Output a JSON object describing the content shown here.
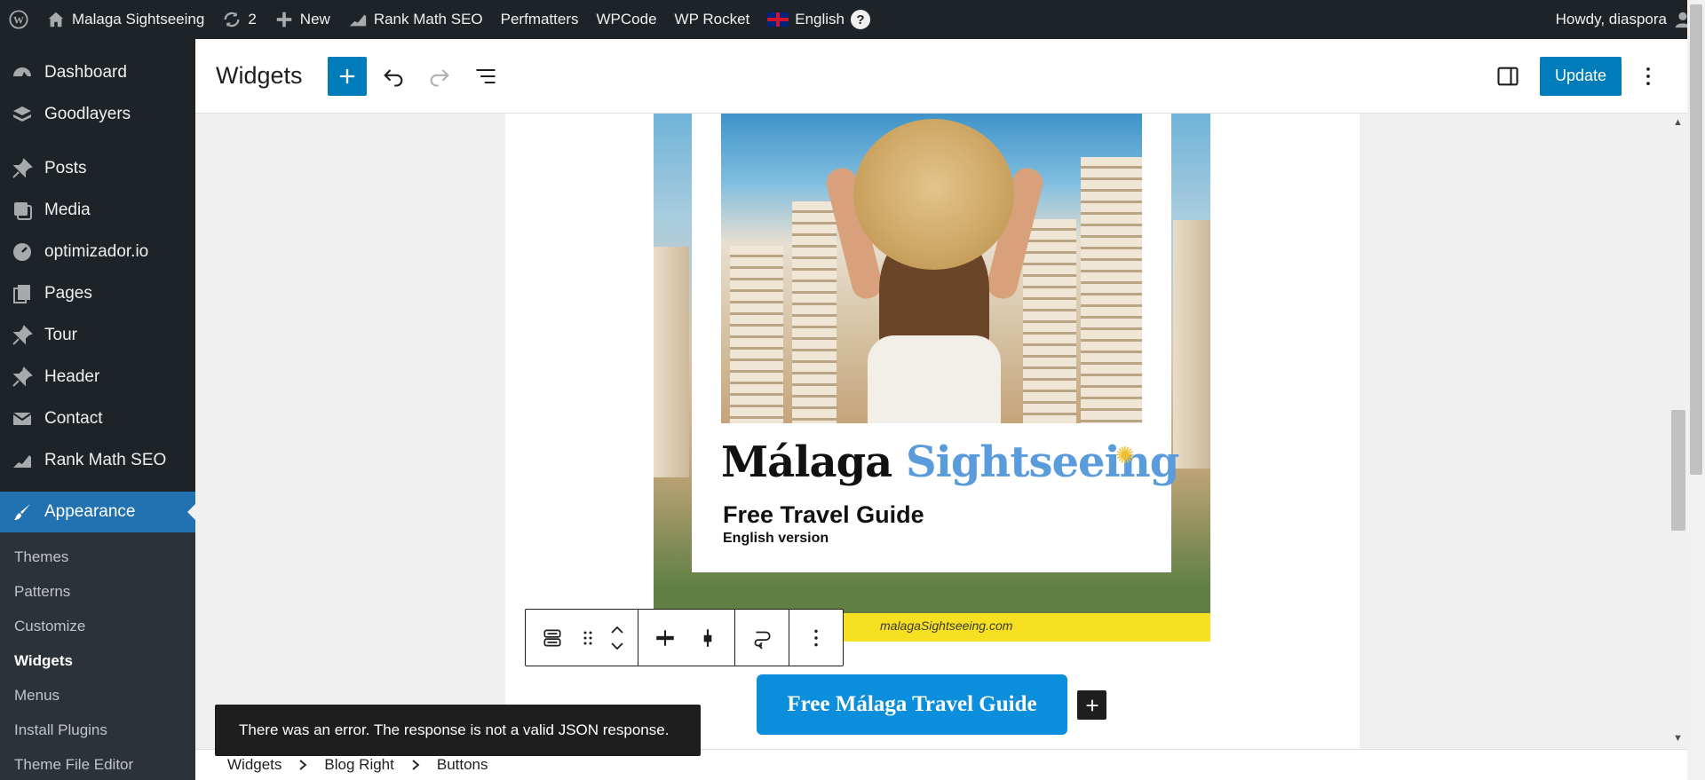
{
  "adminbar": {
    "site_name": "Malaga Sightseeing",
    "updates_count": "2",
    "new_label": "New",
    "rank_math": "Rank Math SEO",
    "perfmatters": "Perfmatters",
    "wpcode": "WPCode",
    "wp_rocket": "WP Rocket",
    "language": "English",
    "help": "?",
    "howdy": "Howdy, diaspora"
  },
  "sidebar": {
    "items": [
      {
        "label": "Dashboard",
        "icon": "dashboard-icon"
      },
      {
        "label": "Goodlayers",
        "icon": "layers-icon"
      },
      {
        "label": "Posts",
        "icon": "pin-icon"
      },
      {
        "label": "Media",
        "icon": "media-icon"
      },
      {
        "label": "optimizador.io",
        "icon": "gauge-icon"
      },
      {
        "label": "Pages",
        "icon": "pages-icon"
      },
      {
        "label": "Tour",
        "icon": "pin-icon"
      },
      {
        "label": "Header",
        "icon": "pin-icon"
      },
      {
        "label": "Contact",
        "icon": "mail-icon"
      },
      {
        "label": "Rank Math SEO",
        "icon": "rank-math-icon"
      }
    ],
    "active": {
      "label": "Appearance",
      "icon": "brush-icon"
    },
    "submenu": [
      "Themes",
      "Patterns",
      "Customize",
      "Widgets",
      "Menus",
      "Install Plugins",
      "Theme File Editor"
    ],
    "current_submenu": "Widgets"
  },
  "editor": {
    "title": "Widgets",
    "update_label": "Update"
  },
  "promo": {
    "brand_part1": "Málaga",
    "brand_part2": "Sightseeing",
    "guide_title": "Free Travel Guide",
    "guide_subtitle": "English version",
    "url": "malagaSightseeing.com"
  },
  "cta_label": "Free Málaga Travel Guide",
  "snackbar": "There was an error. The response is not a valid JSON response.",
  "breadcrumb": [
    "Widgets",
    "Blog Right",
    "Buttons"
  ],
  "colors": {
    "admin_dark": "#1d2327",
    "accent": "#2271b1",
    "primary_button": "#007cba",
    "cta": "#0b8edb",
    "brand_blue": "#5a9bdc"
  }
}
